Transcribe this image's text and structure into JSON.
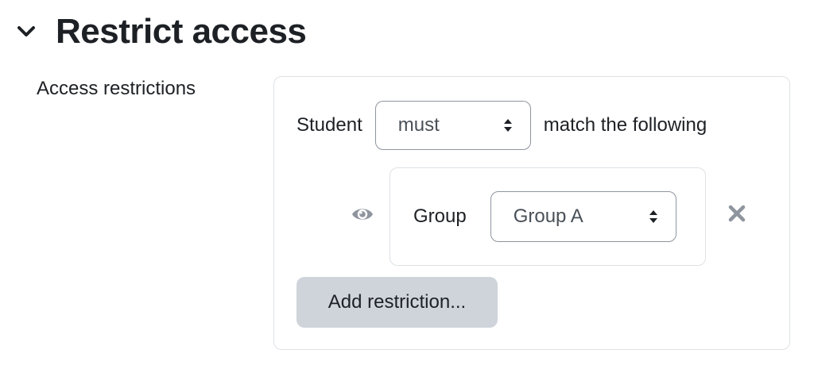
{
  "section": {
    "title": "Restrict access",
    "collapse_icon": "chevron-down-icon"
  },
  "field": {
    "label": "Access restrictions"
  },
  "restrictions": {
    "prefix": "Student",
    "match_select": {
      "value": "must",
      "icon": "sort-caret-icon"
    },
    "suffix": "match the following",
    "condition": {
      "visibility_icon": "eye-icon",
      "type_label": "Group",
      "group_select": {
        "value": "Group A",
        "icon": "sort-caret-icon"
      },
      "delete_icon": "close-icon"
    },
    "add_button": "Add restriction..."
  },
  "colors": {
    "text": "#1d2125",
    "select_text": "#495057",
    "border": "#dee2e6",
    "select_border": "#8f959e",
    "icon": "#8f959e",
    "button_bg": "#ced4da"
  }
}
